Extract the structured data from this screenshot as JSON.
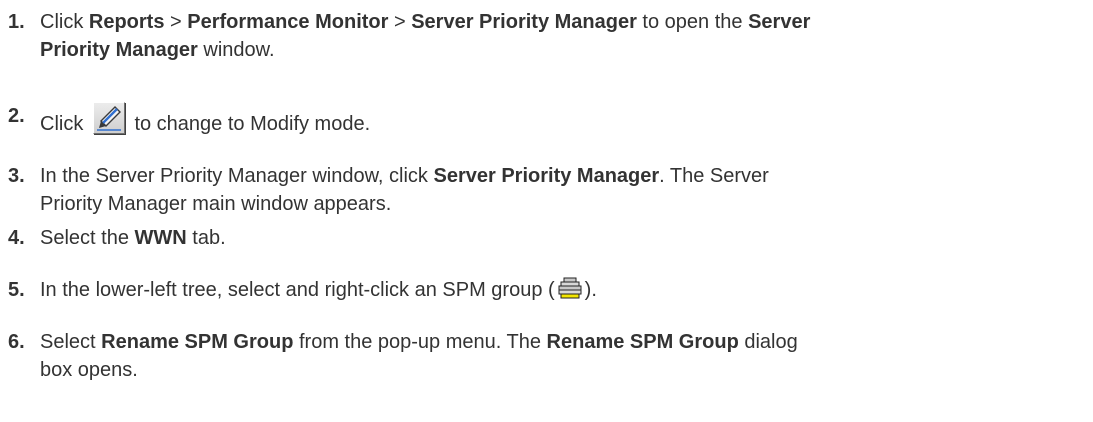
{
  "steps": [
    {
      "number": "1.",
      "t1": "Click ",
      "b1": "Reports",
      "t2": " > ",
      "b2": "Performance Monitor",
      "t3": " > ",
      "b3": "Server Priority Manager",
      "t4": " to open the ",
      "b4": "Server",
      "b5": "Priority Manager",
      "t5": " window."
    },
    {
      "number": "2.",
      "t1": "Click ",
      "t2": " to change to Modify mode."
    },
    {
      "number": "3.",
      "t1": "In the Server Priority Manager window, click ",
      "b1": "Server Priority Manager",
      "t2": ". The Server",
      "t3": "Priority Manager main window appears."
    },
    {
      "number": "4.",
      "t1": "Select the ",
      "b1": "WWN",
      "t2": " tab."
    },
    {
      "number": "5.",
      "t1": "In the lower-left tree, select and right-click an SPM group (",
      "t2": ")."
    },
    {
      "number": "6.",
      "t1": "Select ",
      "b1": "Rename SPM Group",
      "t2": " from the pop-up menu. The ",
      "b2": "Rename SPM Group",
      "t3": " dialog",
      "t4": "box opens."
    }
  ],
  "icons": {
    "modify_mode": "pencil-edit-icon",
    "spm_group": "spm-group-icon"
  },
  "colors": {
    "text": "#333333",
    "background": "#ffffff"
  }
}
